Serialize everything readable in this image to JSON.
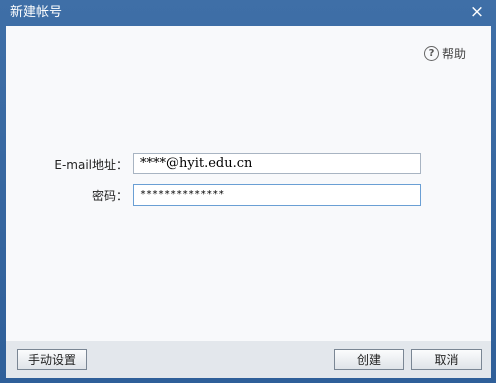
{
  "window": {
    "title": "新建帐号",
    "close_icon": "×"
  },
  "help": {
    "icon": "?",
    "label": "帮助"
  },
  "form": {
    "email_label": "E-mail地址：",
    "email_value": "****@hyit.edu.cn",
    "password_label": "密码：",
    "password_value": "**************"
  },
  "footer": {
    "manual_label": "手动设置",
    "create_label": "创建",
    "cancel_label": "取消"
  }
}
